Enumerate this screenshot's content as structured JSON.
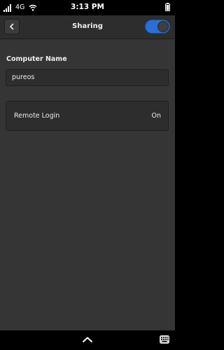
{
  "status": {
    "network": "4G",
    "time": "3:13 PM"
  },
  "header": {
    "title": "Sharing",
    "toggle_state": "on"
  },
  "computer_name": {
    "label": "Computer Name",
    "value": "pureos"
  },
  "remote_login": {
    "label": "Remote Login",
    "value": "On"
  },
  "colors": {
    "accent": "#2a6ed8",
    "background": "#353535",
    "headerbar": "#2d2d2d"
  },
  "icons": [
    "signal-icon",
    "wifi-icon",
    "battery-icon",
    "back-arrow-icon",
    "chevron-up-icon",
    "keyboard-icon"
  ]
}
